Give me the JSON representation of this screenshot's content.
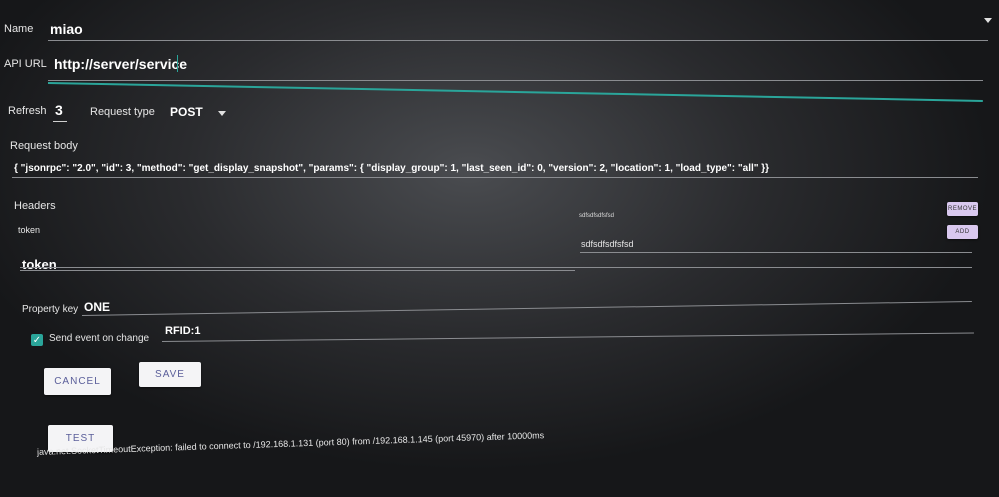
{
  "form": {
    "name_label": "Name",
    "name_value": "miao",
    "api_url_label": "API URL",
    "api_url_value": "http://server/service",
    "refresh_label": "Refresh",
    "refresh_value": "3",
    "request_type_label": "Request type",
    "request_type_value": "POST",
    "request_body_label": "Request body",
    "request_body_value": "{ \"jsonrpc\": \"2.0\", \"id\": 3, \"method\": \"get_display_snapshot\", \"params\": { \"display_group\": 1, \"last_seen_id\": 0, \"version\": 2, \"location\": 1, \"load_type\": \"all\" }}",
    "headers_label": "Headers",
    "header_key_static": "token",
    "header_value_static": "sdfsdfsdfsfsd",
    "remove_label": "REMOVE",
    "add_label": "ADD",
    "header_key_input": "token",
    "header_value_input": "sdfsdfsdfsfsd",
    "property_key_label": "Property key",
    "property_key_value": "ONE",
    "send_event_label": "Send event on change",
    "send_event_value": "RFID:1",
    "cancel_label": "CANCEL",
    "save_label": "SAVE",
    "test_label": "TEST",
    "error_message": "java.net.SocketTimeoutException: failed to connect to /192.168.1.131 (port 80) from /192.168.1.145 (port 45970) after 10000ms"
  },
  "icons": {
    "checkbox": "check-icon",
    "dropdown": "chevron-down-icon"
  },
  "colors": {
    "accent": "#2aa59a",
    "button_text": "#5a5e9a",
    "small_button_bg": "#d9c8ef"
  }
}
